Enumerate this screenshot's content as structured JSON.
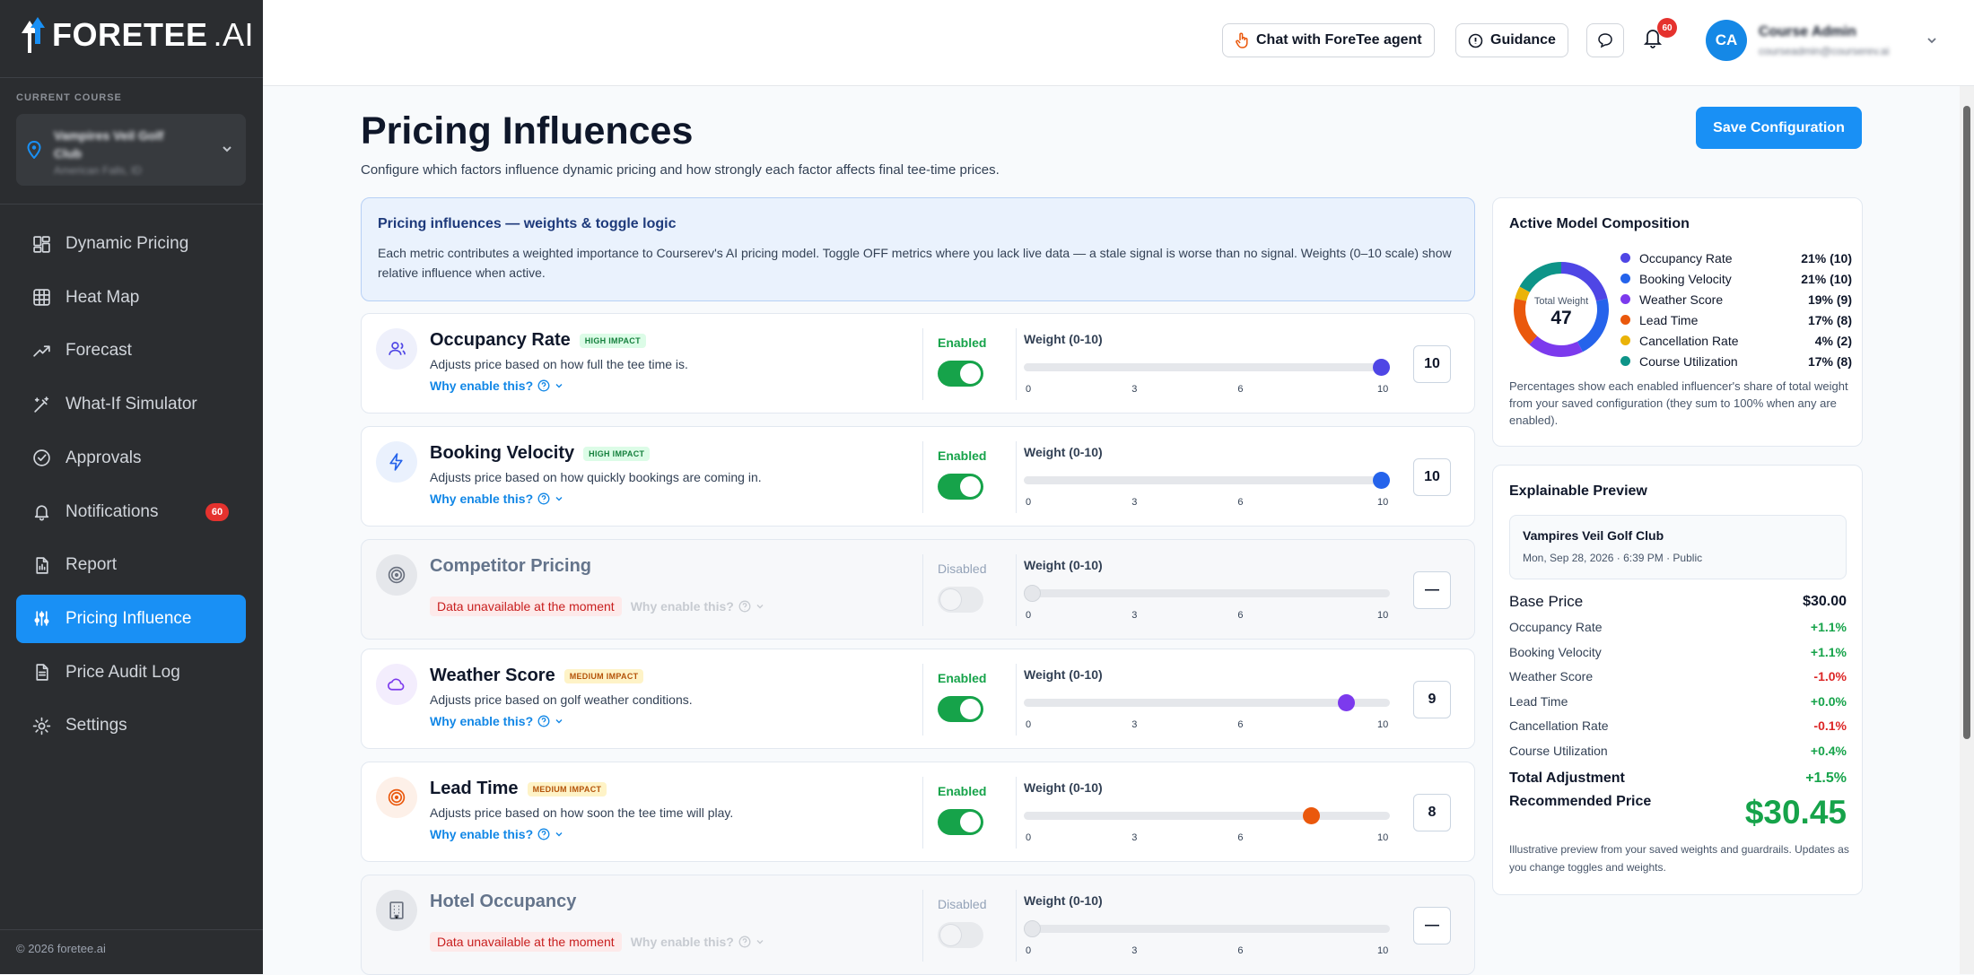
{
  "brand": {
    "name_bold": "FORETEE",
    "name_suffix": ".AI"
  },
  "sidebar": {
    "current_course_label": "CURRENT COURSE",
    "course_name": "Vampires Veil Golf Club",
    "course_location": "American Falls, ID",
    "items": [
      {
        "label": "Dynamic Pricing",
        "icon": "grid-icon"
      },
      {
        "label": "Heat Map",
        "icon": "table-grid-icon"
      },
      {
        "label": "Forecast",
        "icon": "trend-up-icon"
      },
      {
        "label": "What-If Simulator",
        "icon": "magic-wand-icon"
      },
      {
        "label": "Approvals",
        "icon": "check-circle-icon"
      },
      {
        "label": "Notifications",
        "icon": "bell-icon",
        "badge": "60"
      },
      {
        "label": "Report",
        "icon": "report-icon"
      },
      {
        "label": "Pricing Influence",
        "icon": "sliders-icon",
        "active": true
      },
      {
        "label": "Price Audit Log",
        "icon": "document-icon"
      },
      {
        "label": "Settings",
        "icon": "gear-icon"
      }
    ],
    "copyright": "© 2026 foretee.ai"
  },
  "topbar": {
    "chat_label": "Chat with ForeTee agent",
    "guidance_label": "Guidance",
    "notification_count": "60",
    "avatar_initials": "CA",
    "user_name": "Course Admin",
    "user_email": "courseadmin@courserev.ai"
  },
  "page": {
    "title": "Pricing Influences",
    "subtitle": "Configure which factors influence dynamic pricing and how strongly each factor affects final tee-time prices.",
    "save_label": "Save Configuration"
  },
  "info": {
    "title": "Pricing influences — weights & toggle logic",
    "text": "Each metric contributes a weighted importance to Courserev's AI pricing model. Toggle OFF metrics where you lack live data — a stale signal is worse than no signal. Weights (0–10 scale) show relative influence when active."
  },
  "metric_common": {
    "why_label": "Why enable this?",
    "weight_label": "Weight (0-10)",
    "ticks": [
      "0",
      "3",
      "6",
      "10"
    ],
    "unavailable_label": "Data unavailable at the moment",
    "enabled_label": "Enabled",
    "disabled_label": "Disabled"
  },
  "metrics": [
    {
      "name": "Occupancy Rate",
      "impact": "HIGH IMPACT",
      "impact_level": "high",
      "desc": "Adjusts price based on how full the tee time is.",
      "enabled": true,
      "status": "Enabled",
      "weight": 10,
      "display": "10",
      "color": "#4f46e5",
      "icon": "users-icon",
      "icon_bg": "#eef0fb"
    },
    {
      "name": "Booking Velocity",
      "impact": "HIGH IMPACT",
      "impact_level": "high",
      "desc": "Adjusts price based on how quickly bookings are coming in.",
      "enabled": true,
      "status": "Enabled",
      "weight": 10,
      "display": "10",
      "color": "#2563eb",
      "icon": "lightning-icon",
      "icon_bg": "#eaf1fd"
    },
    {
      "name": "Competitor Pricing",
      "impact": "",
      "desc": "",
      "enabled": false,
      "status": "Disabled",
      "weight": 0,
      "display": "—",
      "color": "#6b7280",
      "icon": "target-icon",
      "icon_bg": "#e5e7eb"
    },
    {
      "name": "Weather Score",
      "impact": "MEDIUM IMPACT",
      "impact_level": "med",
      "desc": "Adjusts price based on golf weather conditions.",
      "enabled": true,
      "status": "Enabled",
      "weight": 9,
      "display": "9",
      "color": "#7c3aed",
      "icon": "cloud-icon",
      "icon_bg": "#f3edfd"
    },
    {
      "name": "Lead Time",
      "impact": "MEDIUM IMPACT",
      "impact_level": "med",
      "desc": "Adjusts price based on how soon the tee time will play.",
      "enabled": true,
      "status": "Enabled",
      "weight": 8,
      "display": "8",
      "color": "#ea580c",
      "icon": "target-icon",
      "icon_bg": "#fdf0e8"
    },
    {
      "name": "Hotel Occupancy",
      "impact": "",
      "desc": "",
      "enabled": false,
      "status": "Disabled",
      "weight": 0,
      "display": "—",
      "color": "#6b7280",
      "icon": "building-icon",
      "icon_bg": "#e5e7eb"
    }
  ],
  "composition": {
    "title": "Active Model Composition",
    "total_label": "Total Weight",
    "total": "47",
    "items": [
      {
        "name": "Occupancy Rate",
        "value": "21% (10)",
        "weight": 10,
        "color": "#4f46e5"
      },
      {
        "name": "Booking Velocity",
        "value": "21% (10)",
        "weight": 10,
        "color": "#2563eb"
      },
      {
        "name": "Weather Score",
        "value": "19% (9)",
        "weight": 9,
        "color": "#7c3aed"
      },
      {
        "name": "Lead Time",
        "value": "17% (8)",
        "weight": 8,
        "color": "#ea580c"
      },
      {
        "name": "Cancellation Rate",
        "value": "4% (2)",
        "weight": 2,
        "color": "#eab308"
      },
      {
        "name": "Course Utilization",
        "value": "17% (8)",
        "weight": 8,
        "color": "#0d9488"
      }
    ],
    "note": "Percentages show each enabled influencer's share of total weight from your saved configuration (they sum to 100% when any are enabled)."
  },
  "preview": {
    "title": "Explainable Preview",
    "course": "Vampires Veil Golf Club",
    "slot": "Mon, Sep 28, 2026 · 6:39 PM · Public",
    "base_label": "Base Price",
    "base_value": "$30.00",
    "rows": [
      {
        "label": "Occupancy Rate",
        "value": "+1.1%",
        "sign": "pos"
      },
      {
        "label": "Booking Velocity",
        "value": "+1.1%",
        "sign": "pos"
      },
      {
        "label": "Weather Score",
        "value": "-1.0%",
        "sign": "neg"
      },
      {
        "label": "Lead Time",
        "value": "+0.0%",
        "sign": "pos"
      },
      {
        "label": "Cancellation Rate",
        "value": "-0.1%",
        "sign": "neg"
      },
      {
        "label": "Course Utilization",
        "value": "+0.4%",
        "sign": "pos"
      }
    ],
    "total_label": "Total Adjustment",
    "total_value": "+1.5%",
    "rec_label": "Recommended Price",
    "rec_value": "$30.45",
    "note": "Illustrative preview from your saved weights and guardrails. Updates as you change toggles and weights."
  }
}
